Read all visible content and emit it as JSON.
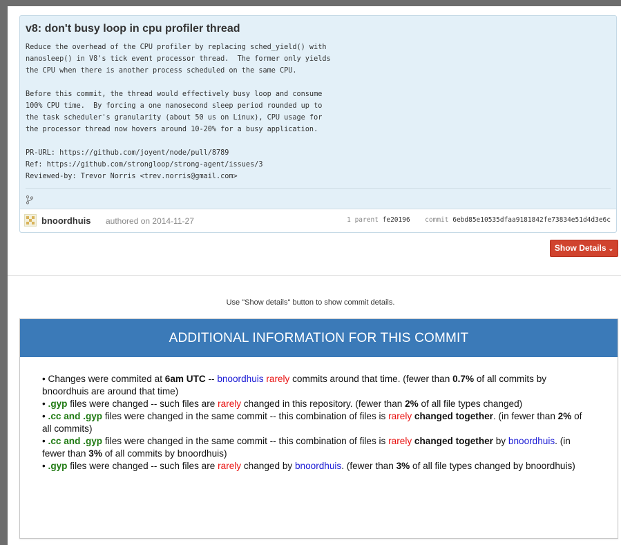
{
  "commit": {
    "title": "v8: don't busy loop in cpu profiler thread",
    "message": "Reduce the overhead of the CPU profiler by replacing sched_yield() with\nnanosleep() in V8's tick event processor thread.  The former only yields\nthe CPU when there is another process scheduled on the same CPU.\n\nBefore this commit, the thread would effectively busy loop and consume\n100% CPU time.  By forcing a one nanosecond sleep period rounded up to\nthe task scheduler's granularity (about 50 us on Linux), CPU usage for\nthe processor thread now hovers around 10-20% for a busy application.\n\nPR-URL: https://github.com/joyent/node/pull/8789\nRef: https://github.com/strongloop/strong-agent/issues/3\nReviewed-by: Trevor Norris <trev.norris@gmail.com>",
    "author": "bnoordhuis",
    "authored_text": "authored on 2014-11-27",
    "parent_label": "1 parent",
    "parent_sha": "fe20196",
    "commit_label": "commit",
    "commit_sha": "6ebd85e10535dfaa9181842fe73834e51d4d3e6c",
    "branch_icon": "git-branch-icon"
  },
  "show_details": {
    "label": "Show Details",
    "chevron": "⌄"
  },
  "hint_text": "Use \"Show details\" button to show commit details.",
  "panel": {
    "title": "ADDITIONAL INFORMATION FOR THIS COMMIT",
    "items": [
      {
        "p1": "• Changes were commited at ",
        "p2": "6am UTC",
        "p3": " -- ",
        "p4": "bnoordhuis",
        "p5": " ",
        "p6": "rarely",
        "p7": " commits around that time. (fewer than ",
        "p8": "0.7%",
        "p9": " of all commits by bnoordhuis are around that time)"
      },
      {
        "p1": "• ",
        "p2": ".gyp",
        "p3": " files were changed -- such files are ",
        "p4": "rarely",
        "p5": " changed in this repository. (fewer than ",
        "p6": "2%",
        "p7": " of all file types changed)"
      },
      {
        "p1": "• ",
        "p2": ".cc and .gyp",
        "p3": " files were changed in the same commit -- this combination of files is ",
        "p4": "rarely",
        "p5": " ",
        "p6": "changed together",
        "p7": ". (in fewer than ",
        "p8": "2%",
        "p9": " of all commits)"
      },
      {
        "p1": "• ",
        "p2": ".cc and .gyp",
        "p3": " files were changed in the same commit -- this combination of files is ",
        "p4": "rarely",
        "p5": " ",
        "p6": "changed together",
        "p7": " by ",
        "p8": "bnoordhuis",
        "p9": ". (in fewer than ",
        "p10": "3%",
        "p11": " of all commits by bnoordhuis)"
      },
      {
        "p1": "• ",
        "p2": ".gyp",
        "p3": " files were changed -- such files are ",
        "p4": "rarely",
        "p5": " changed by ",
        "p6": "bnoordhuis",
        "p7": ". (fewer than ",
        "p8": "3%",
        "p9": " of all file types changed by bnoordhuis)"
      }
    ]
  },
  "colors": {
    "header_blue": "#3b7ab8",
    "button_red": "#d0432e",
    "highlight_red": "#e8100f",
    "author_blue": "#1a1ad4",
    "filetype_green": "#1f7a12",
    "commit_bg": "#e3f0f8"
  }
}
